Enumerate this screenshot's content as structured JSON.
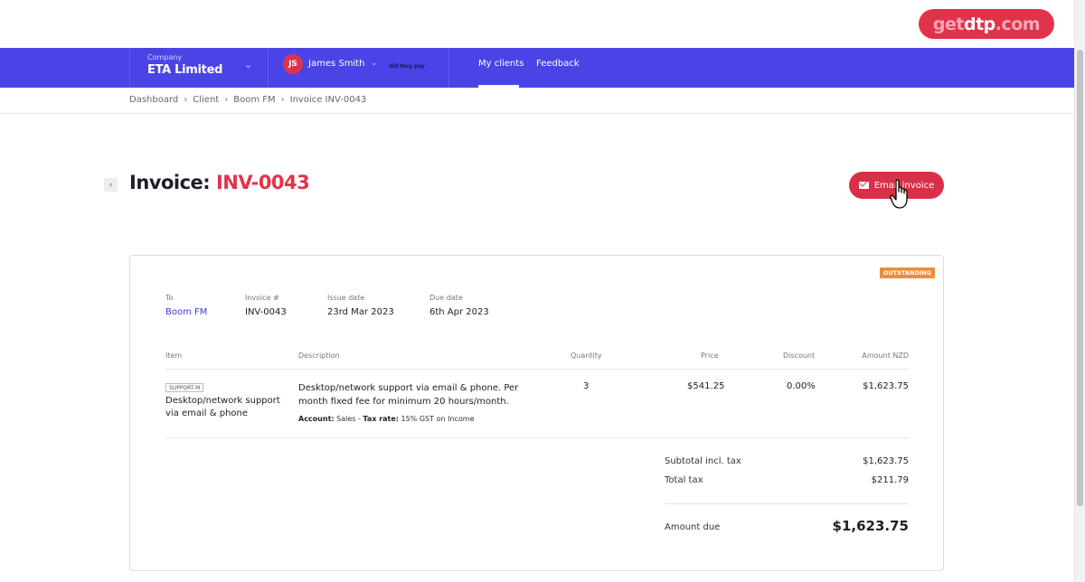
{
  "logo": {
    "part1": "get",
    "part2": "dtp",
    "part3": ".com"
  },
  "nav": {
    "company_label": "Company",
    "company_name": "ETA Limited",
    "user_initials": "JS",
    "user_name": "James Smith",
    "brand_mini": "did they pay",
    "tabs": [
      {
        "label": "My clients",
        "active": true
      },
      {
        "label": "Feedback",
        "active": false
      }
    ]
  },
  "breadcrumb": [
    "Dashboard",
    "Client",
    "Boom FM",
    "Invoice INV-0043"
  ],
  "page": {
    "title_prefix": "Invoice:",
    "title_number": "INV-0043",
    "email_button": "Email invoice"
  },
  "invoice": {
    "status": "OUTSTANDING",
    "to_label": "To",
    "to_value": "Boom FM",
    "number_label": "Invoice #",
    "number_value": "INV-0043",
    "issue_label": "Issue date",
    "issue_value": "23rd Mar 2023",
    "due_label": "Due date",
    "due_value": "6th Apr 2023",
    "columns": {
      "item": "Item",
      "description": "Description",
      "quantity": "Quantity",
      "price": "Price",
      "discount": "Discount",
      "amount": "Amount NZD"
    },
    "line": {
      "code": "SUPPORT-M",
      "item_name": "Desktop/network support via email & phone",
      "description": "Desktop/network support via email & phone. Per month fixed fee for minimum 20 hours/month.",
      "account_label": "Account:",
      "account_value": "Sales",
      "tax_label": "Tax rate:",
      "tax_value": "15% GST on Income",
      "quantity": "3",
      "price": "$541.25",
      "discount": "0.00%",
      "amount": "$1,623.75"
    },
    "totals": {
      "subtotal_label": "Subtotal incl. tax",
      "subtotal_value": "$1,623.75",
      "tax_label": "Total tax",
      "tax_value": "$211.79",
      "due_label": "Amount due",
      "due_value": "$1,623.75"
    }
  },
  "colors": {
    "nav": "#4a44e6",
    "accent": "#e0334b",
    "status": "#f08c3b"
  }
}
